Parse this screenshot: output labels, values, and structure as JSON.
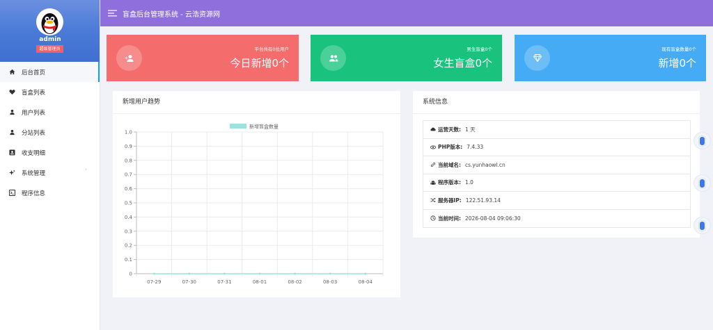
{
  "sidebar": {
    "admin_name": "admin",
    "admin_role": "超级管理员",
    "items": [
      {
        "label": "后台首页",
        "icon": "home-icon",
        "active": true
      },
      {
        "label": "盲盒列表",
        "icon": "heart-icon"
      },
      {
        "label": "用户列表",
        "icon": "user-icon"
      },
      {
        "label": "分站列表",
        "icon": "user-icon"
      },
      {
        "label": "收支明细",
        "icon": "id-card-icon"
      },
      {
        "label": "系统管理",
        "icon": "sparkle-icon",
        "caret": "˅"
      },
      {
        "label": "程序信息",
        "icon": "terminal-icon"
      }
    ]
  },
  "header": {
    "title": "盲盒后台管理系统 - 云浩资源网"
  },
  "stats": [
    {
      "small": "平台共有0位用户",
      "big": "今日新增0个",
      "icon": "user-add-icon",
      "color": "#f56c6c"
    },
    {
      "small": "男生盲盒0个",
      "big": "女生盲盒0个",
      "icon": "users-icon",
      "color": "#19c37d"
    },
    {
      "small": "现有盲盒数量0个",
      "big": "新增0个",
      "icon": "diamond-icon",
      "color": "#45abf4"
    }
  ],
  "chart_panel": {
    "title": "新增用户趋势"
  },
  "chart_data": {
    "type": "line",
    "categories": [
      "07-29",
      "07-30",
      "07-31",
      "08-01",
      "08-02",
      "08-03",
      "08-04"
    ],
    "series": [
      {
        "name": "新增盲盒数量",
        "values": [
          0,
          0,
          0,
          0,
          0,
          0,
          0
        ],
        "color": "#9be3dd"
      }
    ],
    "ylim": [
      0,
      1.0
    ],
    "yticks": [
      "0",
      "0.1",
      "0.2",
      "0.3",
      "0.4",
      "0.5",
      "0.6",
      "0.7",
      "0.8",
      "0.9",
      "1.0"
    ],
    "grid": true,
    "legend": "top-center"
  },
  "info_panel": {
    "title": "系统信息",
    "rows": [
      {
        "key": "运营天数:",
        "value": "1 天",
        "icon": "cloud-icon"
      },
      {
        "key": "PHP版本:",
        "value": "7.4.33",
        "icon": "eye-icon"
      },
      {
        "key": "当前域名:",
        "value": "cs.yunhaowl.cn",
        "icon": "link-icon"
      },
      {
        "key": "程序版本:",
        "value": "1.0",
        "icon": "android-icon"
      },
      {
        "key": "服务器IP:",
        "value": "122.51.93.14",
        "icon": "shuffle-icon"
      },
      {
        "key": "当前时间:",
        "value": "2026-08-04 09:06:30",
        "icon": "clock-icon"
      }
    ]
  }
}
